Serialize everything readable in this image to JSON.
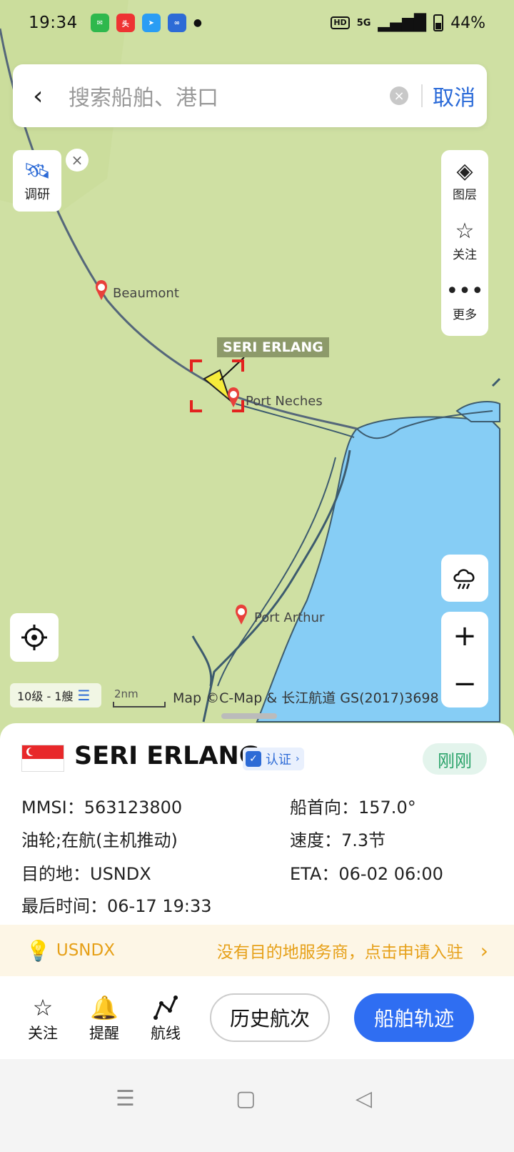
{
  "status": {
    "time": "19:34",
    "battery": "44%",
    "network": "5G",
    "hd": "HD"
  },
  "search": {
    "placeholder": "搜索船舶、港口",
    "cancel": "取消"
  },
  "tools": {
    "survey": "调研",
    "layers": "图层",
    "follow": "关注",
    "more": "更多"
  },
  "map": {
    "places": [
      "Beaumont",
      "Port Neches",
      "Port Arthur"
    ],
    "ship_label": "SERI ERLANG",
    "level_text": "10级 - 1艘",
    "scale_text": "2nm",
    "copyright": "Map ©C-Map & 长江航道 GS(2017)3698"
  },
  "ship": {
    "name": "SERI ERLANG",
    "verify": "认证",
    "time_badge": "刚刚",
    "mmsi_label": "MMSI：",
    "mmsi": "563123800",
    "heading_label": "船首向：",
    "heading": "157.0°",
    "status": "油轮;在航(主机推动)",
    "speed_label": "速度：",
    "speed": "7.3节",
    "dest_label": "目的地：",
    "dest": "USNDX",
    "eta_label": "ETA：",
    "eta": "06-02 06:00",
    "last_label": "最后时间：",
    "last": "06-17 19:33"
  },
  "notice": {
    "code": "USNDX",
    "message": "没有目的地服务商，点击申请入驻"
  },
  "actions": {
    "follow": "关注",
    "remind": "提醒",
    "route": "航线",
    "history": "历史航次",
    "track": "船舶轨迹"
  },
  "colors": {
    "accent": "#2f6ef2",
    "notice": "#e6a018",
    "badge": "#2aa36a",
    "water": "#86cdf5",
    "land": "#cfe0a3"
  }
}
